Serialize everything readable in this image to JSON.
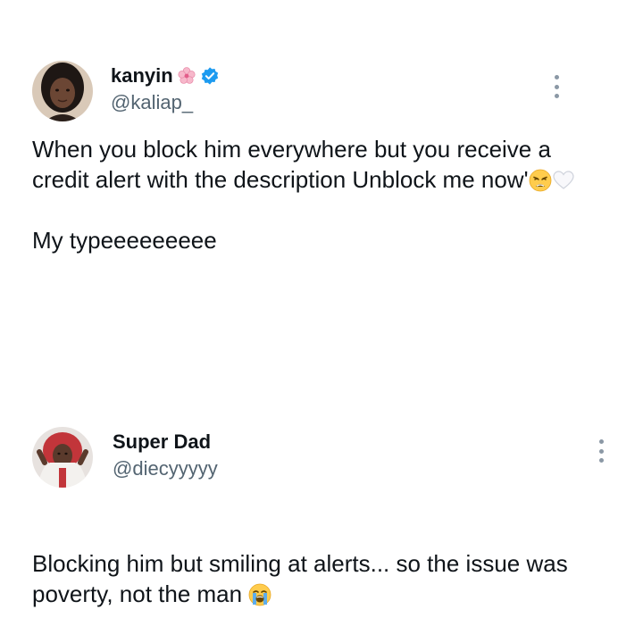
{
  "tweets": [
    {
      "display_name": "kanyin",
      "name_emoji": "cherry-blossom",
      "verified": true,
      "handle": "@kaliap_",
      "text_part1": "When you block him everywhere but you receive a credit alert with the description Unblock me now'",
      "text_emojis": [
        "weary-face",
        "white-heart"
      ],
      "text_part2": "My typeeeeeeeee"
    },
    {
      "display_name": "Super Dad",
      "handle": "@diecyyyyy",
      "text": "Blocking him but smiling at alerts... so the issue was poverty, not the man",
      "text_emojis": [
        "loudly-crying-face"
      ]
    }
  ],
  "colors": {
    "text": "#0f1419",
    "secondary": "#536471",
    "verified": "#1d9bf0",
    "background": "#ffffff"
  }
}
